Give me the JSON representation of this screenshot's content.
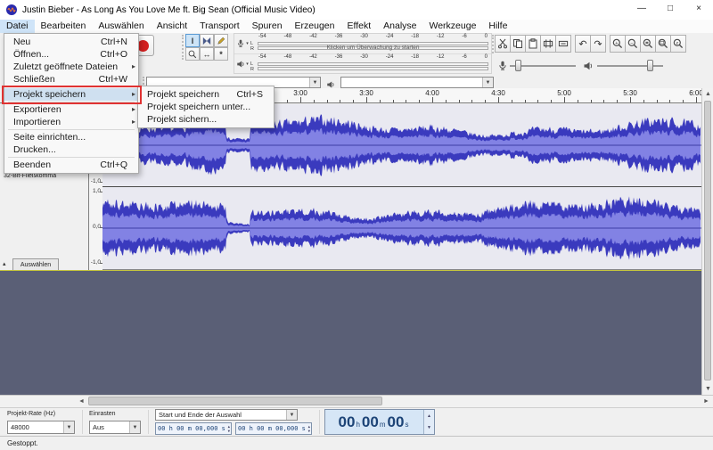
{
  "window": {
    "title": "Justin Bieber - As Long As You Love Me ft. Big Sean (Official Music Video)",
    "controls": [
      "minimize",
      "maximize",
      "close"
    ]
  },
  "menubar": {
    "items": [
      "Datei",
      "Bearbeiten",
      "Auswählen",
      "Ansicht",
      "Transport",
      "Spuren",
      "Erzeugen",
      "Effekt",
      "Analyse",
      "Werkzeuge",
      "Hilfe"
    ],
    "open_menu": "Datei"
  },
  "file_menu": {
    "items": [
      {
        "label": "Neu",
        "shortcut": "Ctrl+N"
      },
      {
        "label": "Öffnen...",
        "shortcut": "Ctrl+O"
      },
      {
        "label": "Zuletzt geöffnete Dateien",
        "submenu": true
      },
      {
        "label": "Schließen",
        "shortcut": "Ctrl+W"
      },
      {
        "sep": true
      },
      {
        "label": "Projekt speichern",
        "submenu": true,
        "highlight": true
      },
      {
        "sep": true
      },
      {
        "label": "Exportieren",
        "submenu": true
      },
      {
        "label": "Importieren",
        "submenu": true
      },
      {
        "sep": true
      },
      {
        "label": "Seite einrichten..."
      },
      {
        "label": "Drucken..."
      },
      {
        "sep": true
      },
      {
        "label": "Beenden",
        "shortcut": "Ctrl+Q"
      }
    ]
  },
  "save_submenu": {
    "items": [
      {
        "label": "Projekt speichern",
        "shortcut": "Ctrl+S"
      },
      {
        "label": "Projekt speichern unter..."
      },
      {
        "label": "Projekt sichern..."
      }
    ]
  },
  "toolbars": {
    "transport": [
      {
        "name": "pause-button",
        "icon": "pause-icon"
      },
      {
        "name": "play-button",
        "icon": "play-icon"
      },
      {
        "name": "stop-button",
        "icon": "stop-icon"
      },
      {
        "name": "skip-to-start-button",
        "icon": "skip-start-icon"
      },
      {
        "name": "skip-to-end-button",
        "icon": "skip-end-icon"
      },
      {
        "name": "record-button",
        "icon": "record-icon"
      }
    ],
    "tools": [
      {
        "name": "selection-tool",
        "icon": "ibeam-icon",
        "glyph": "I",
        "active": true
      },
      {
        "name": "envelope-tool",
        "icon": "envelope-icon",
        "svg": "envelope"
      },
      {
        "name": "draw-tool",
        "icon": "pencil-icon",
        "svg": "pencil"
      },
      {
        "name": "zoom-tool",
        "icon": "magnifier-icon",
        "svg": "magnifier"
      },
      {
        "name": "timeshift-tool",
        "icon": "double-arrow-icon",
        "glyph": "↔"
      },
      {
        "name": "multi-tool",
        "icon": "star-icon",
        "glyph": "*"
      }
    ],
    "edit": [
      {
        "name": "cut-button",
        "svg": "cut"
      },
      {
        "name": "copy-button",
        "svg": "copy"
      },
      {
        "name": "paste-button",
        "svg": "paste"
      },
      {
        "name": "trim-audio-button",
        "svg": "trim"
      },
      {
        "name": "silence-audio-button",
        "svg": "silence"
      },
      {
        "name": "undo-button",
        "glyph": "↶"
      },
      {
        "name": "redo-button",
        "glyph": "↷"
      },
      {
        "name": "zoom-in-button",
        "svg": "zoomin"
      },
      {
        "name": "zoom-out-button",
        "svg": "zoomout"
      },
      {
        "name": "zoom-selection-button",
        "svg": "zoomsel"
      },
      {
        "name": "zoom-fit-button",
        "svg": "zoomfit"
      },
      {
        "name": "zoom-toggle-button",
        "svg": "zoomtoggle"
      }
    ],
    "mixer": [
      {
        "name": "recording-volume-slider",
        "icon": "microphone-icon"
      },
      {
        "name": "playback-volume-slider",
        "icon": "speaker-icon"
      }
    ],
    "device_combos": [
      "audio-host-select",
      "playback-device-select"
    ]
  },
  "meters": {
    "channels": [
      "L",
      "R"
    ],
    "scale": [
      "-54",
      "-48",
      "-42",
      "-36",
      "-30",
      "-24",
      "-18",
      "-12",
      "-6",
      "0"
    ],
    "record_hint": "Klicken um Überwachung zu starten"
  },
  "ruler": {
    "labels": [
      "3:00",
      "3:30",
      "4:00",
      "4:30",
      "5:00",
      "5:30",
      "6:00"
    ]
  },
  "track": {
    "format": "32-Bit-Fließkomma",
    "select_button": "Auswählen",
    "collapse_glyph": "▴",
    "scale": {
      "top": "1,0",
      "mid": "0,0",
      "bottom": "-1,0"
    }
  },
  "selection_toolbar": {
    "rate_label": "Projekt-Rate (Hz)",
    "rate_value": "48000",
    "snap_label": "Einrasten",
    "snap_value": "Aus",
    "selection_label": "Start und Ende der Auswahl",
    "sel_start": "00 h 00 m 00,000 s",
    "sel_end": "00 h 00 m 00,000 s",
    "time_display": [
      {
        "v": "00",
        "u": "h"
      },
      {
        "v": "00",
        "u": "m"
      },
      {
        "v": "00",
        "u": "s"
      }
    ]
  },
  "status": "Gestoppt.",
  "colors": {
    "waveform_peak": "#3a3abe",
    "waveform_rms": "#8282e4",
    "waveform_center": "#22228c",
    "annotation_red": "#e03232",
    "empty_area": "#5a5f76",
    "time_text": "#1d4477",
    "time_bg": "#d6e6f6"
  }
}
